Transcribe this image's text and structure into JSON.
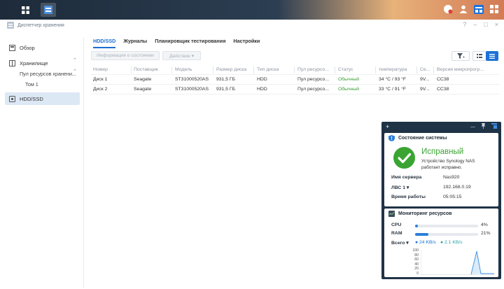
{
  "window": {
    "title": "Диспетчер хранения"
  },
  "sidebar": {
    "overview": "Обзор",
    "storage": "Хранилище",
    "pool": "Пул ресурсов хранени...",
    "volume": "Том 1",
    "hdd": "HDD/SSD"
  },
  "tabs": [
    "HDD/SSD",
    "Журналы",
    "Планировщик тестирования",
    "Настройки"
  ],
  "toolbar": {
    "info": "Информация о состоянии",
    "action": "Действие ▾"
  },
  "table": {
    "headers": [
      "Номер",
      "Поставщик",
      "Модель",
      "Размер диска",
      "Тип диска",
      "Пул ресурсо...",
      "Статус",
      "температура",
      "Се...",
      "Версия микропрогр..."
    ],
    "rows": [
      [
        "Диск 1",
        "Seagate",
        "ST31000520AS",
        "931,5 ГБ",
        "HDD",
        "Пул ресурсо...",
        "Обычный",
        "34 °C / 93 °F",
        "9V...",
        "CC38"
      ],
      [
        "Диск 2",
        "Seagate",
        "ST31000520AS",
        "931,5 ГБ",
        "HDD",
        "Пул ресурсо...",
        "Обычный",
        "33 °C / 91 °F",
        "9V...",
        "CC38"
      ]
    ]
  },
  "widget": {
    "plus": "+",
    "system_title": "Состояние системы",
    "health": "Исправный",
    "health_desc": "Устройство Synology NAS работает исправно.",
    "server_label": "Имя сервера",
    "server_value": "Nas920",
    "lan_label": "ЛВС 1 ▾",
    "lan_value": "192.168.0.19",
    "uptime_label": "Время работы",
    "uptime_value": "05:05:15",
    "monitor_title": "Мониторинг ресурсов",
    "cpu_label": "CPU",
    "cpu_value": "4%",
    "cpu_pct": 4,
    "ram_label": "RAM",
    "ram_value": "21%",
    "ram_pct": 21,
    "total_label": "Всего ▾",
    "up_rate": "24 KB/s",
    "down_rate": "2.1 KB/s",
    "axis_ticks": [
      "100",
      "80",
      "60",
      "40",
      "20",
      "0"
    ]
  },
  "colors": {
    "accent": "#1b6ecf",
    "ok": "#3c9e33",
    "widget_bg": "#1f3346"
  }
}
